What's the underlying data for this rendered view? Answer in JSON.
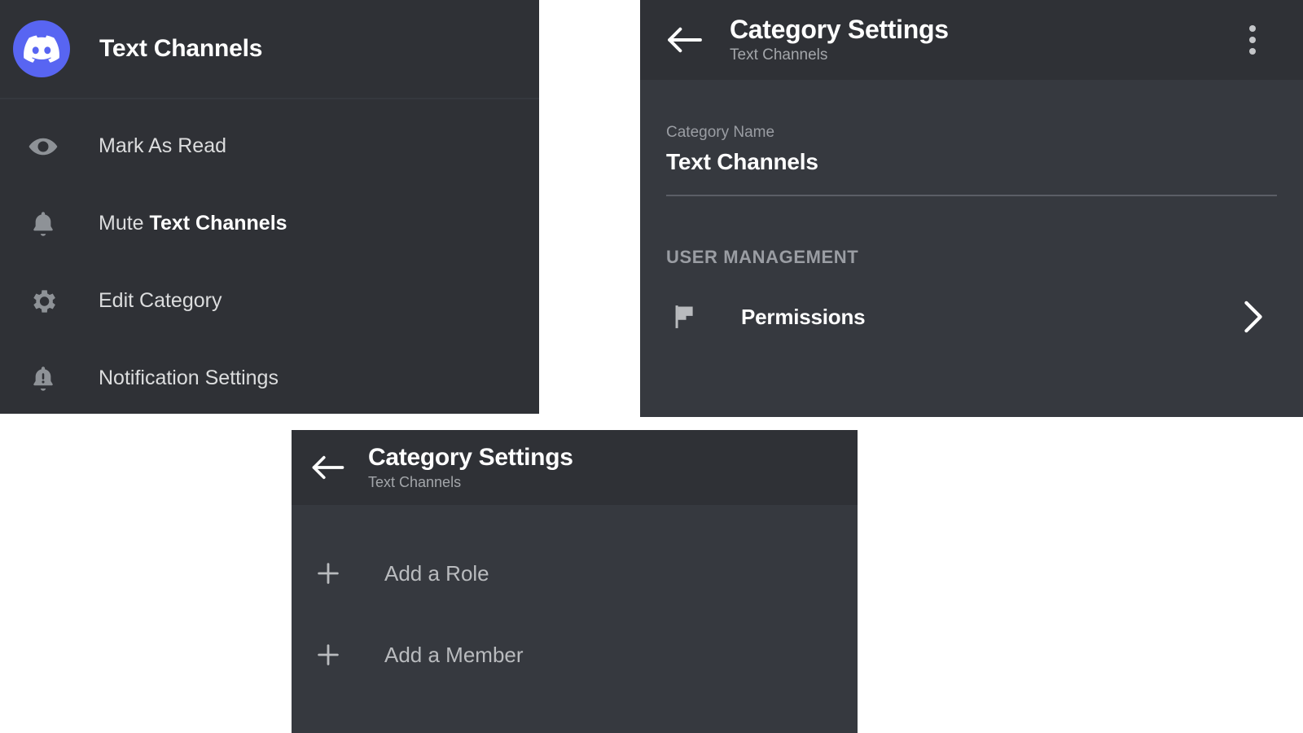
{
  "context_menu": {
    "app_icon": "discord-logo-icon",
    "title": "Text Channels",
    "items": [
      {
        "icon": "eye-icon",
        "label": "Mark As Read",
        "bold_part": ""
      },
      {
        "icon": "bell-icon",
        "label": "Mute ",
        "bold_part": "Text Channels"
      },
      {
        "icon": "gear-icon",
        "label": "Edit Category",
        "bold_part": ""
      },
      {
        "icon": "bell-alert-icon",
        "label": "Notification Settings",
        "bold_part": ""
      }
    ]
  },
  "category_settings": {
    "back_icon": "back-arrow-icon",
    "title": "Category Settings",
    "subtitle": "Text Channels",
    "overflow_icon": "more-vertical-icon",
    "name_field": {
      "label": "Category Name",
      "value": "Text Channels"
    },
    "section_title": "USER MANAGEMENT",
    "rows": [
      {
        "icon": "flag-icon",
        "label": "Permissions",
        "chevron": "chevron-right-icon"
      }
    ]
  },
  "permissions_screen": {
    "back_icon": "back-arrow-icon",
    "title": "Category Settings",
    "subtitle": "Text Channels",
    "items": [
      {
        "icon": "plus-icon",
        "label": "Add a Role"
      },
      {
        "icon": "plus-icon",
        "label": "Add a Member"
      }
    ]
  },
  "colors": {
    "brand_blurple": "#5865F2",
    "panel_dark": "#2F3136",
    "panel_body": "#36393F",
    "text_primary": "#FFFFFF",
    "text_secondary": "#B9BBBE",
    "text_muted": "#9A9DA3"
  }
}
